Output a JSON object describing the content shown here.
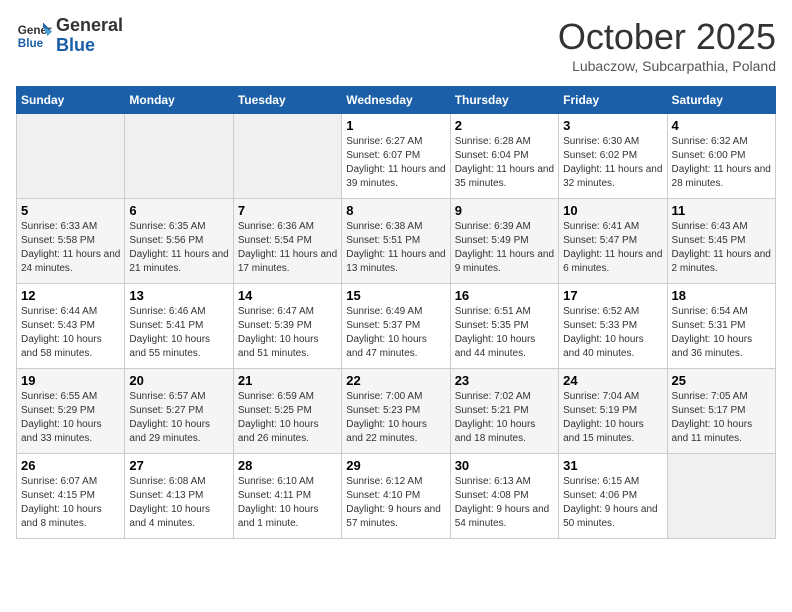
{
  "header": {
    "logo_line1": "General",
    "logo_line2": "Blue",
    "month": "October 2025",
    "location": "Lubaczow, Subcarpathia, Poland"
  },
  "weekdays": [
    "Sunday",
    "Monday",
    "Tuesday",
    "Wednesday",
    "Thursday",
    "Friday",
    "Saturday"
  ],
  "weeks": [
    [
      {
        "day": "",
        "empty": true
      },
      {
        "day": "",
        "empty": true
      },
      {
        "day": "",
        "empty": true
      },
      {
        "day": "1",
        "sunrise": "6:27 AM",
        "sunset": "6:07 PM",
        "daylight": "11 hours and 39 minutes."
      },
      {
        "day": "2",
        "sunrise": "6:28 AM",
        "sunset": "6:04 PM",
        "daylight": "11 hours and 35 minutes."
      },
      {
        "day": "3",
        "sunrise": "6:30 AM",
        "sunset": "6:02 PM",
        "daylight": "11 hours and 32 minutes."
      },
      {
        "day": "4",
        "sunrise": "6:32 AM",
        "sunset": "6:00 PM",
        "daylight": "11 hours and 28 minutes."
      }
    ],
    [
      {
        "day": "5",
        "sunrise": "6:33 AM",
        "sunset": "5:58 PM",
        "daylight": "11 hours and 24 minutes."
      },
      {
        "day": "6",
        "sunrise": "6:35 AM",
        "sunset": "5:56 PM",
        "daylight": "11 hours and 21 minutes."
      },
      {
        "day": "7",
        "sunrise": "6:36 AM",
        "sunset": "5:54 PM",
        "daylight": "11 hours and 17 minutes."
      },
      {
        "day": "8",
        "sunrise": "6:38 AM",
        "sunset": "5:51 PM",
        "daylight": "11 hours and 13 minutes."
      },
      {
        "day": "9",
        "sunrise": "6:39 AM",
        "sunset": "5:49 PM",
        "daylight": "11 hours and 9 minutes."
      },
      {
        "day": "10",
        "sunrise": "6:41 AM",
        "sunset": "5:47 PM",
        "daylight": "11 hours and 6 minutes."
      },
      {
        "day": "11",
        "sunrise": "6:43 AM",
        "sunset": "5:45 PM",
        "daylight": "11 hours and 2 minutes."
      }
    ],
    [
      {
        "day": "12",
        "sunrise": "6:44 AM",
        "sunset": "5:43 PM",
        "daylight": "10 hours and 58 minutes."
      },
      {
        "day": "13",
        "sunrise": "6:46 AM",
        "sunset": "5:41 PM",
        "daylight": "10 hours and 55 minutes."
      },
      {
        "day": "14",
        "sunrise": "6:47 AM",
        "sunset": "5:39 PM",
        "daylight": "10 hours and 51 minutes."
      },
      {
        "day": "15",
        "sunrise": "6:49 AM",
        "sunset": "5:37 PM",
        "daylight": "10 hours and 47 minutes."
      },
      {
        "day": "16",
        "sunrise": "6:51 AM",
        "sunset": "5:35 PM",
        "daylight": "10 hours and 44 minutes."
      },
      {
        "day": "17",
        "sunrise": "6:52 AM",
        "sunset": "5:33 PM",
        "daylight": "10 hours and 40 minutes."
      },
      {
        "day": "18",
        "sunrise": "6:54 AM",
        "sunset": "5:31 PM",
        "daylight": "10 hours and 36 minutes."
      }
    ],
    [
      {
        "day": "19",
        "sunrise": "6:55 AM",
        "sunset": "5:29 PM",
        "daylight": "10 hours and 33 minutes."
      },
      {
        "day": "20",
        "sunrise": "6:57 AM",
        "sunset": "5:27 PM",
        "daylight": "10 hours and 29 minutes."
      },
      {
        "day": "21",
        "sunrise": "6:59 AM",
        "sunset": "5:25 PM",
        "daylight": "10 hours and 26 minutes."
      },
      {
        "day": "22",
        "sunrise": "7:00 AM",
        "sunset": "5:23 PM",
        "daylight": "10 hours and 22 minutes."
      },
      {
        "day": "23",
        "sunrise": "7:02 AM",
        "sunset": "5:21 PM",
        "daylight": "10 hours and 18 minutes."
      },
      {
        "day": "24",
        "sunrise": "7:04 AM",
        "sunset": "5:19 PM",
        "daylight": "10 hours and 15 minutes."
      },
      {
        "day": "25",
        "sunrise": "7:05 AM",
        "sunset": "5:17 PM",
        "daylight": "10 hours and 11 minutes."
      }
    ],
    [
      {
        "day": "26",
        "sunrise": "6:07 AM",
        "sunset": "4:15 PM",
        "daylight": "10 hours and 8 minutes."
      },
      {
        "day": "27",
        "sunrise": "6:08 AM",
        "sunset": "4:13 PM",
        "daylight": "10 hours and 4 minutes."
      },
      {
        "day": "28",
        "sunrise": "6:10 AM",
        "sunset": "4:11 PM",
        "daylight": "10 hours and 1 minute."
      },
      {
        "day": "29",
        "sunrise": "6:12 AM",
        "sunset": "4:10 PM",
        "daylight": "9 hours and 57 minutes."
      },
      {
        "day": "30",
        "sunrise": "6:13 AM",
        "sunset": "4:08 PM",
        "daylight": "9 hours and 54 minutes."
      },
      {
        "day": "31",
        "sunrise": "6:15 AM",
        "sunset": "4:06 PM",
        "daylight": "9 hours and 50 minutes."
      },
      {
        "day": "",
        "empty": true
      }
    ]
  ]
}
